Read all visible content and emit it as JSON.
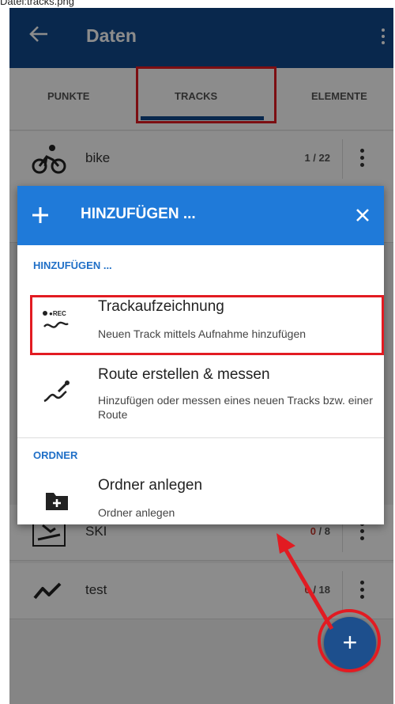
{
  "doc_label": "Datei:tracks.png",
  "appbar": {
    "title": "Daten"
  },
  "tabs": [
    {
      "label": "PUNKTE"
    },
    {
      "label": "TRACKS"
    },
    {
      "label": "ELEMENTE"
    }
  ],
  "list": [
    {
      "name": "bike",
      "count_done": "",
      "count_total": "1 / 22"
    },
    {
      "name": "SKI",
      "count_done": "0",
      "count_total": " / 8"
    },
    {
      "name": "test",
      "count_done": "0",
      "count_total": " / 18"
    }
  ],
  "dialog": {
    "title": "HINZUFÜGEN ...",
    "section_add": "HINZUFÜGEN ...",
    "item_record": {
      "title": "Trackaufzeichnung",
      "subtitle": "Neuen Track mittels Aufnahme hinzufügen",
      "icon_text": "●REC"
    },
    "item_route": {
      "title": "Route erstellen & messen",
      "subtitle": "Hinzufügen oder messen eines neuen Tracks bzw. einer Route"
    },
    "section_folder": "ORDNER",
    "item_folder": {
      "title": "Ordner anlegen",
      "subtitle": "Ordner anlegen"
    }
  },
  "fab": {
    "label": "+"
  },
  "colors": {
    "appbar": "#114a8c",
    "dialog_header": "#1f7ad9",
    "accent": "#1f6fc7",
    "highlight": "#e21b22"
  }
}
